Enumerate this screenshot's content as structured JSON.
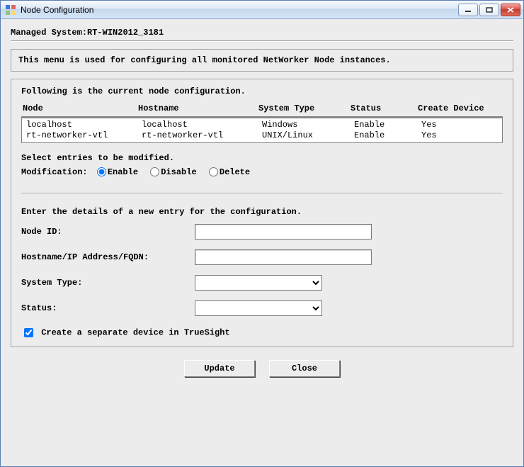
{
  "window": {
    "title": "Node Configuration"
  },
  "header": {
    "managed_system_label": "Managed System:",
    "managed_system_value": "RT-WIN2012_3181"
  },
  "description": "This menu is used for configuring all monitored NetWorker Node instances.",
  "config_section": {
    "intro": "Following is the current node configuration.",
    "columns": {
      "node": "Node",
      "hostname": "Hostname",
      "system_type": "System Type",
      "status": "Status",
      "create_device": "Create Device"
    },
    "rows": [
      {
        "node": "localhost",
        "hostname": "localhost",
        "system_type": "Windows",
        "status": "Enable",
        "create_device": "Yes"
      },
      {
        "node": "rt-networker-vtl",
        "hostname": "rt-networker-vtl",
        "system_type": "UNIX/Linux",
        "status": "Enable",
        "create_device": "Yes"
      }
    ],
    "select_entries_label": "Select entries to be modified.",
    "modification_label": "Modification:",
    "options": {
      "enable": "Enable",
      "disable": "Disable",
      "delete": "Delete"
    },
    "selected": "enable"
  },
  "new_entry": {
    "intro": "Enter the details of a new entry for the configuration.",
    "node_id_label": "Node ID:",
    "node_id_value": "",
    "hostname_label": "Hostname/IP Address/FQDN:",
    "hostname_value": "",
    "system_type_label": "System Type:",
    "system_type_value": "",
    "status_label": "Status:",
    "status_value": "",
    "checkbox_label": "Create a separate device in TrueSight",
    "checkbox_checked": true
  },
  "buttons": {
    "update": "Update",
    "close": "Close"
  }
}
